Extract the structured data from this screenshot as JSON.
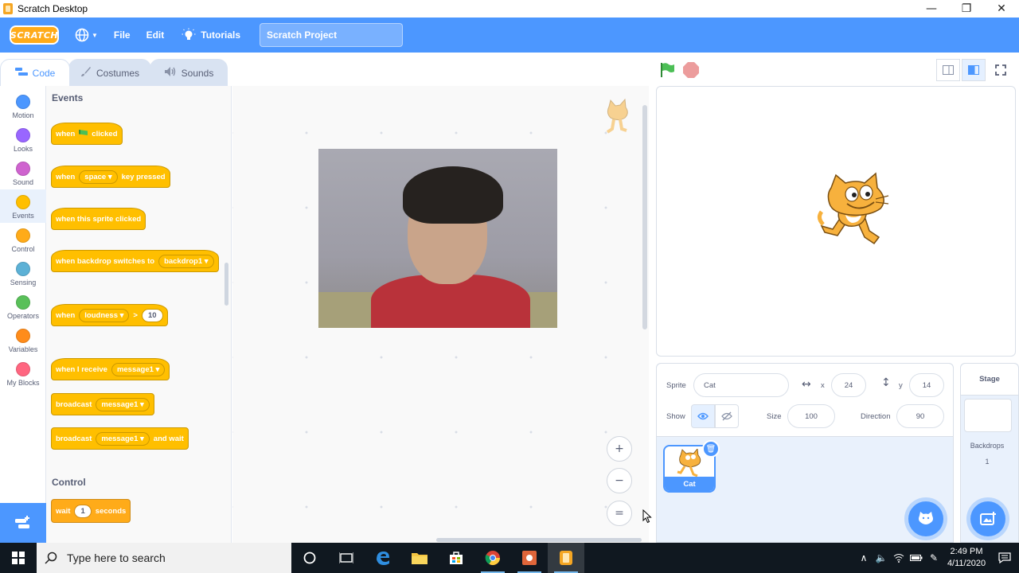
{
  "window": {
    "title": "Scratch Desktop",
    "minimize_glyph": "—",
    "restore_glyph": "❐",
    "close_glyph": "✕"
  },
  "menubar": {
    "logo_text": "SCRATCH",
    "file": "File",
    "edit": "Edit",
    "tutorials": "Tutorials",
    "project_title": "Scratch Project"
  },
  "tabs": [
    {
      "label": "Code",
      "icon": "code-icon",
      "active": true
    },
    {
      "label": "Costumes",
      "icon": "brush-icon",
      "active": false
    },
    {
      "label": "Sounds",
      "icon": "speaker-icon",
      "active": false
    }
  ],
  "categories": [
    {
      "label": "Motion",
      "color": "#4c97ff"
    },
    {
      "label": "Looks",
      "color": "#9966ff"
    },
    {
      "label": "Sound",
      "color": "#cf63cf"
    },
    {
      "label": "Events",
      "color": "#ffbf00",
      "active": true
    },
    {
      "label": "Control",
      "color": "#ffab19"
    },
    {
      "label": "Sensing",
      "color": "#5cb1d6"
    },
    {
      "label": "Operators",
      "color": "#59c059"
    },
    {
      "label": "Variables",
      "color": "#ff8c1a"
    },
    {
      "label": "My Blocks",
      "color": "#ff6680"
    }
  ],
  "palette": {
    "events_heading": "Events",
    "control_heading": "Control",
    "blocks": {
      "flag_when": "when",
      "flag_clicked": "clicked",
      "key_when": "when",
      "key_value": "space",
      "key_pressed": "key pressed",
      "sprite_clicked": "when this sprite clicked",
      "backdrop_switch": "when backdrop switches to",
      "backdrop_value": "backdrop1",
      "loudness_when": "when",
      "loudness_value": "loudness",
      "loudness_op": ">",
      "loudness_num": "10",
      "receive": "when I receive",
      "receive_value": "message1",
      "broadcast": "broadcast",
      "broadcast_value": "message1",
      "broadcast_wait": "broadcast",
      "broadcast_wait_value": "message1",
      "broadcast_wait_suffix": "and wait",
      "wait": "wait",
      "wait_num": "1",
      "wait_suffix": "seconds"
    }
  },
  "script_area": {
    "zoom_in_glyph": "+",
    "zoom_out_glyph": "−",
    "zoom_reset_glyph": "="
  },
  "sprite_info": {
    "sprite_label": "Sprite",
    "sprite_name": "Cat",
    "x_label": "x",
    "x_value": "24",
    "y_label": "y",
    "y_value": "14",
    "show_label": "Show",
    "size_label": "Size",
    "size_value": "100",
    "direction_label": "Direction",
    "direction_value": "90",
    "thumb_name": "Cat"
  },
  "stage_pane": {
    "header": "Stage",
    "backdrops_label": "Backdrops",
    "backdrops_count": "1"
  },
  "taskbar": {
    "search_placeholder": "Type here to search",
    "time": "2:49 PM",
    "date": "4/11/2020"
  },
  "colors": {
    "scratch_blue": "#4c97ff",
    "events_yellow": "#ffbf00",
    "taskbar_bg": "#101820"
  }
}
